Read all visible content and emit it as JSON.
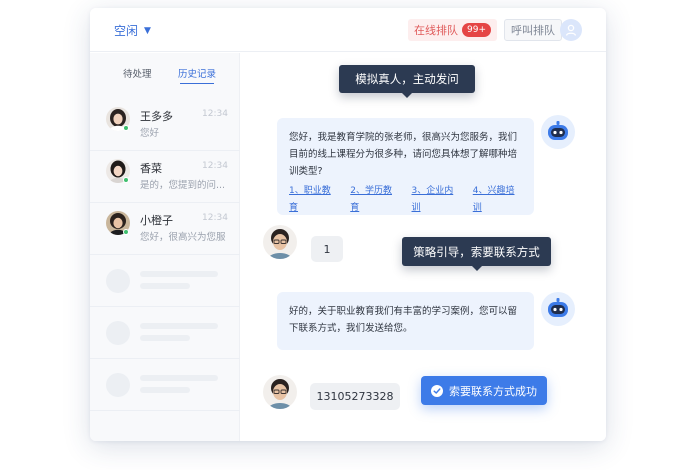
{
  "header": {
    "status_label": "空闲",
    "queue_label": "在线排队",
    "queue_count": "99+",
    "call_queue_label": "呼叫排队"
  },
  "sidebar": {
    "tabs": [
      {
        "label": "待处理"
      },
      {
        "label": "历史记录"
      }
    ],
    "contacts": [
      {
        "name": "王多多",
        "time": "12:34",
        "preview": "您好"
      },
      {
        "name": "香菜",
        "time": "12:34",
        "preview": "是的，您提到的问..."
      },
      {
        "name": "小橙子",
        "time": "12:34",
        "preview": "您好，很高兴为您服..."
      }
    ]
  },
  "chat": {
    "tip1": "模拟真人，主动发问",
    "bot_message_1": "您好，我是教育学院的张老师，很高兴为您服务，我们目前的线上课程分为很多种，请问您具体想了解哪种培训类型?",
    "links": [
      "1、职业教育",
      "2、学历教育",
      "3、企业内训",
      "4、兴趣培训"
    ],
    "user_message_1": "1",
    "tip2": "策略引导，索要联系方式",
    "bot_message_2": "好的，关于职业教育我们有丰富的学习案例，您可以留下联系方式，我们发送给您。",
    "user_message_2": "13105273328",
    "success_label": "索要联系方式成功"
  },
  "colors": {
    "accent": "#3a6fd8",
    "tip_bg": "#2c3a52",
    "bot_bubble_bg": "#edf3fd",
    "success_bg": "#3d7be8",
    "badge": "#e54545"
  }
}
